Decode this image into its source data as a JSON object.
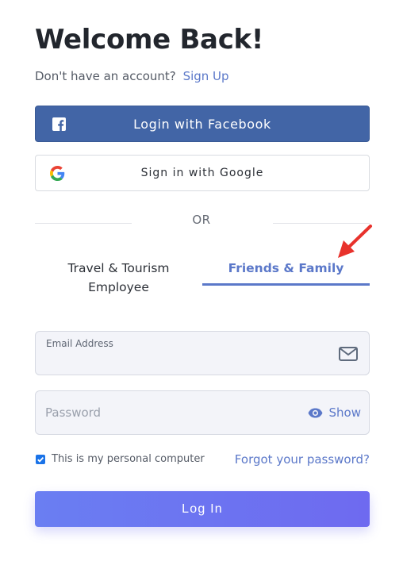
{
  "heading": {
    "title": "Welcome Back!"
  },
  "signup": {
    "prompt": "Don't have an account?",
    "link": "Sign Up"
  },
  "social": {
    "facebook_label": "Login with Facebook",
    "google_label": "Sign in with Google"
  },
  "separator": {
    "text": "OR"
  },
  "tabs": [
    {
      "label": "Travel & Tourism Employee",
      "line1": "Travel & Tourism",
      "line2": "Employee",
      "active": false
    },
    {
      "label": "Friends & Family",
      "active": true
    }
  ],
  "form": {
    "email_label": "Email Address",
    "email_value": "",
    "password_placeholder": "Password",
    "password_value": "",
    "show_label": "Show",
    "remember_label": "This is my personal computer",
    "remember_checked": true,
    "forgot_label": "Forgot your password?",
    "submit_label": "Log In"
  },
  "colors": {
    "accent": "#5b78c9",
    "facebook": "#4265a6",
    "login_gradient_start": "#6a7ef2",
    "login_gradient_end": "#6e6af0",
    "annotation_arrow": "#e8322c"
  },
  "icons": {
    "facebook": "facebook-icon",
    "google": "google-icon",
    "email": "mail-icon",
    "show": "eye-icon",
    "annotation": "red-arrow-icon",
    "checkbox": "checkmark-icon"
  }
}
